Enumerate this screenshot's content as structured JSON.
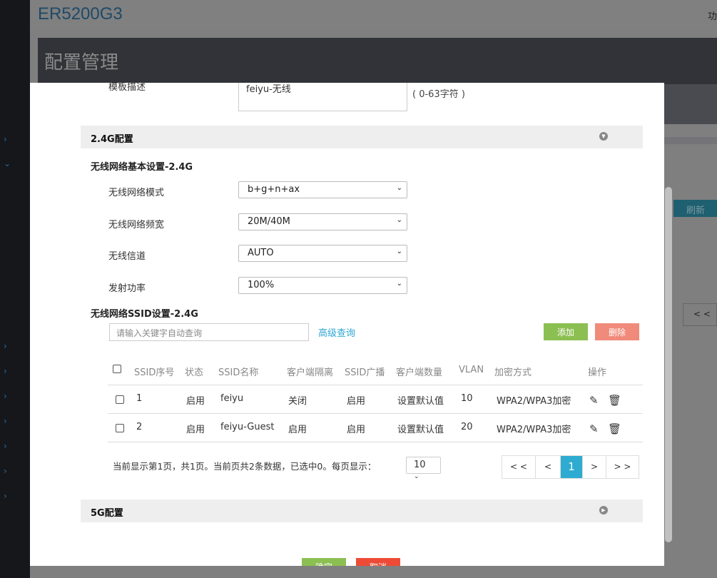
{
  "header": {
    "brand": "ER5200G3",
    "top_right": "功",
    "page_title": "配置管理"
  },
  "background": {
    "refresh_label": "刷新",
    "prev_label": "< <"
  },
  "modal": {
    "template_desc_label": "模板描述",
    "template_desc_value": "feiyu-无线",
    "template_desc_hint": "( 0-63字符 )",
    "section_24": "2.4G配置",
    "basic_title": "无线网络基本设置-2.4G",
    "fields": [
      {
        "label": "无线网络模式",
        "value": "b+g+n+ax"
      },
      {
        "label": "无线网络频宽",
        "value": "20M/40M"
      },
      {
        "label": "无线信道",
        "value": "AUTO"
      },
      {
        "label": "发射功率",
        "value": "100%"
      }
    ],
    "ssid_title": "无线网络SSID设置-2.4G",
    "search_placeholder": "请输入关键字自动查询",
    "advanced_search": "高级查询",
    "add_label": "添加",
    "delete_label": "删除",
    "columns": [
      "SSID序号",
      "状态",
      "SSID名称",
      "客户端隔离",
      "SSID广播",
      "客户端数量",
      "VLAN",
      "加密方式",
      "操作"
    ],
    "rows": [
      [
        "1",
        "启用",
        "feiyu",
        "关闭",
        "启用",
        "设置默认值",
        "10",
        "WPA2/WPA3加密"
      ],
      [
        "2",
        "启用",
        "feiyu-Guest",
        "启用",
        "启用",
        "设置默认值",
        "20",
        "WPA2/WPA3加密"
      ]
    ],
    "page_info": "当前显示第1页，共1页。当前页共2条数据，已选中0。每页显示：",
    "per_page": "10",
    "pager": [
      "< <",
      "<",
      "1",
      ">",
      "> >"
    ],
    "section_5g": "5G配置",
    "ok_label": "确定",
    "cancel_label": "取消"
  },
  "colors": {
    "add": "#8cbf52",
    "delete": "#f08a7a",
    "accent": "#2eabd1",
    "ok": "#8cbf52",
    "cancel": "#ee4b36"
  }
}
